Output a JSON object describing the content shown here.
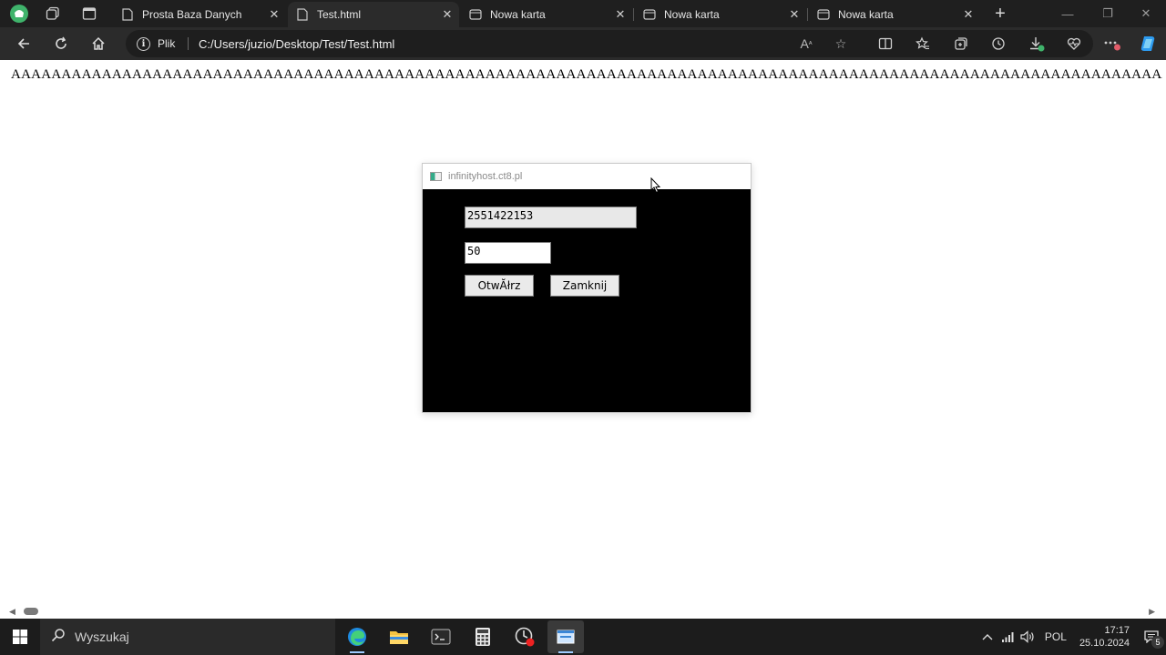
{
  "browser": {
    "tabs": [
      {
        "title": "Prosta Baza Danych",
        "active": false
      },
      {
        "title": "Test.html",
        "active": true
      },
      {
        "title": "Nowa karta",
        "active": false
      },
      {
        "title": "Nowa karta",
        "active": false
      },
      {
        "title": "Nowa karta",
        "active": false
      }
    ],
    "site_info_label": "Plik",
    "url": "C:/Users/juzio/Desktop/Test/Test.html"
  },
  "page": {
    "long_text": "AAAAAAAAAAAAAAAAAAAAAAAAAAAAAAAAAAAAAAAAAAAAAAAAAAAAAAAAAAAAAAAAAAAAAAAAAAAAAAAAAAAAAAAAAAAAAAAAAAAAAAAAAAAAAAAAAAAAAAAAAAA"
  },
  "popup": {
    "title": "infinityhost.ct8.pl",
    "id_value": "2551422153",
    "number_value": "50",
    "open_button_label": "OtwĂłrz",
    "close_button_label": "Zamknij"
  },
  "taskbar": {
    "search_placeholder": "Wyszukaj",
    "language": "POL",
    "time": "17:17",
    "date": "25.10.2024",
    "notification_count": "5"
  },
  "colors": {
    "tab_strip": "#1f1f1f",
    "toolbar": "#2b2b2b",
    "popup_body": "#000000",
    "taskbar": "#1c1c1c"
  }
}
